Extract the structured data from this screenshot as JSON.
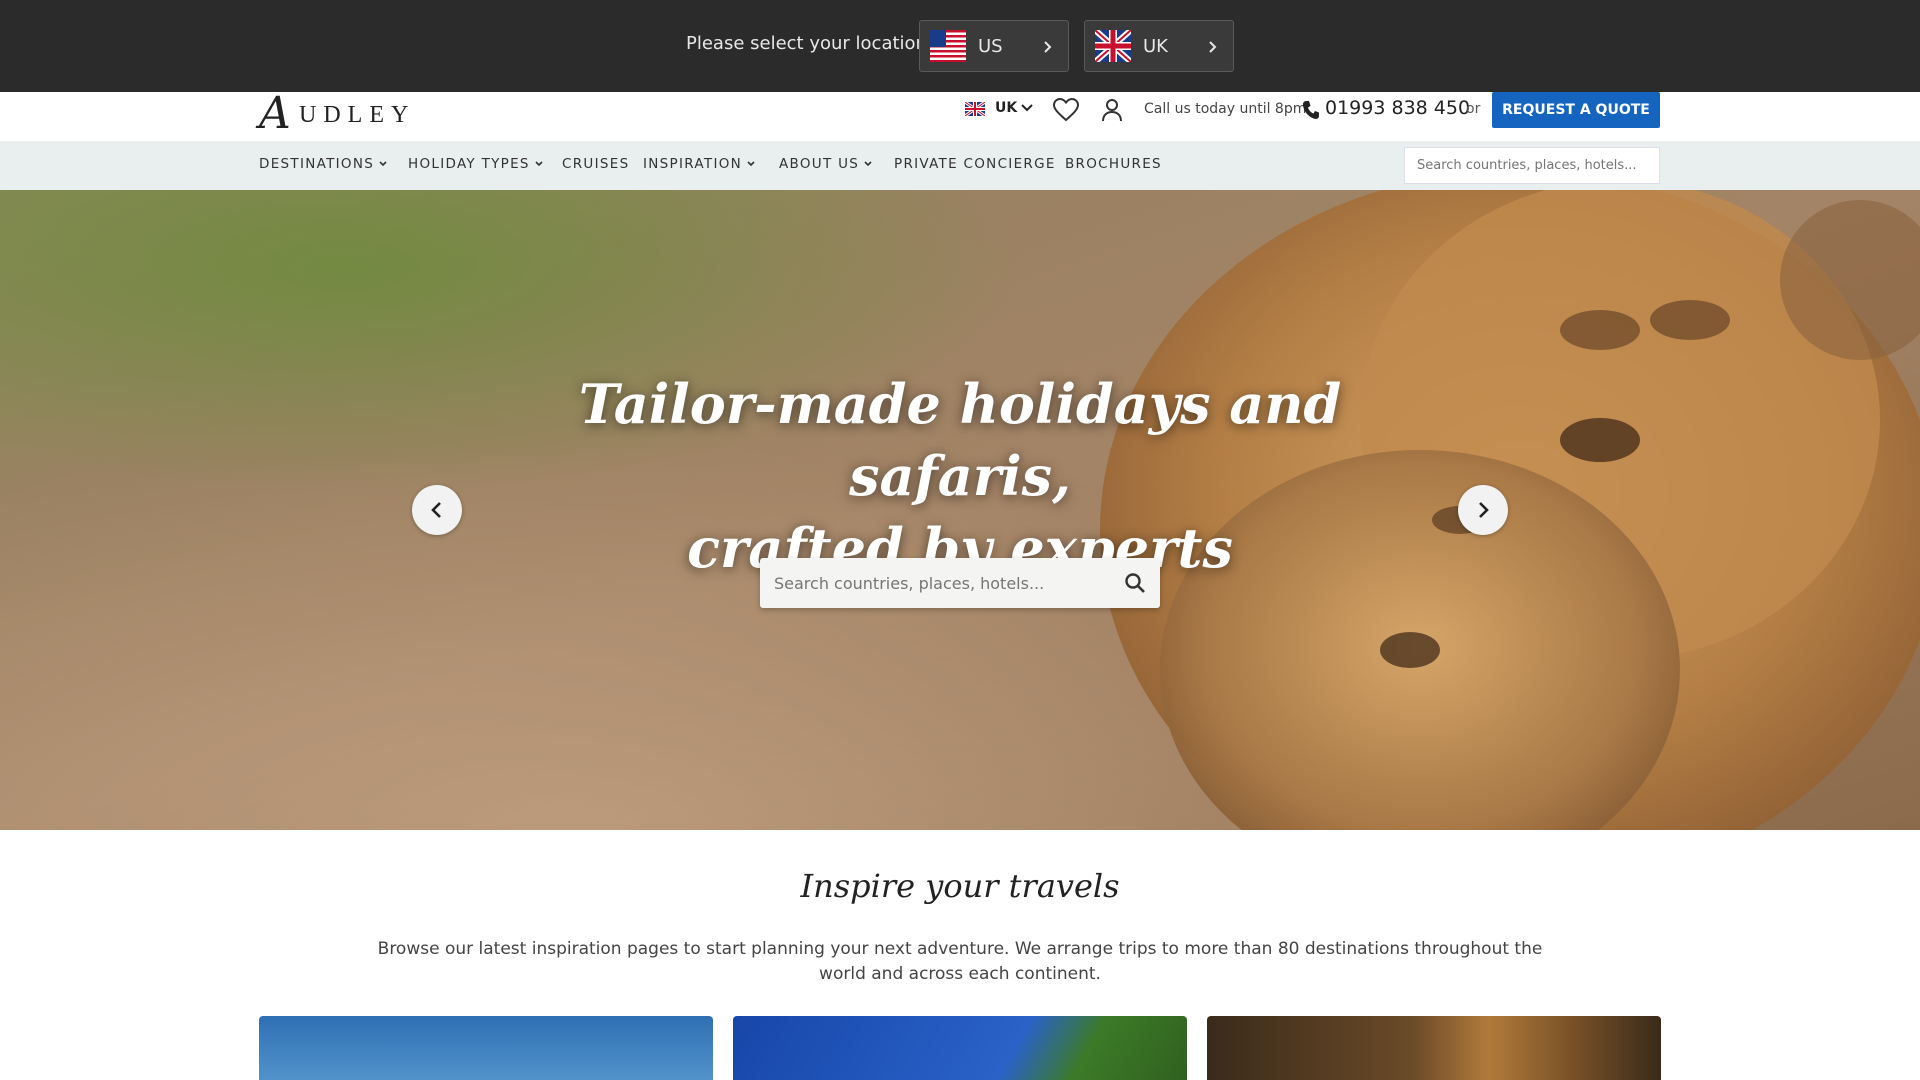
{
  "location_bar": {
    "prompt": "Please select your location:",
    "options": [
      {
        "label": "US",
        "flag": "us-flag-icon"
      },
      {
        "label": "UK",
        "flag": "uk-flag-icon"
      }
    ]
  },
  "header": {
    "logo_initial": "A",
    "logo_rest": "UDLEY",
    "country": "UK",
    "call_text": "Call us today until 8pm",
    "phone": "01993 838 450",
    "or_text": "or",
    "quote_button": "REQUEST A QUOTE"
  },
  "nav": {
    "items": [
      {
        "label": "DESTINATIONS",
        "dropdown": true
      },
      {
        "label": "HOLIDAY TYPES",
        "dropdown": true
      },
      {
        "label": "CRUISES",
        "dropdown": false
      },
      {
        "label": "INSPIRATION",
        "dropdown": true
      },
      {
        "label": "ABOUT US",
        "dropdown": true
      },
      {
        "label": "PRIVATE CONCIERGE",
        "dropdown": false
      },
      {
        "label": "BROCHURES",
        "dropdown": false
      }
    ],
    "search_placeholder": "Search countries, places, hotels..."
  },
  "hero": {
    "title_line1": "Tailor-made holidays and safaris,",
    "title_line2": "crafted by experts",
    "search_placeholder": "Search countries, places, hotels..."
  },
  "inspire": {
    "title": "Inspire your travels",
    "text": "Browse our latest inspiration pages to start planning your next adventure. We arrange trips to more than 80 destinations throughout the world and across each continent."
  },
  "colors": {
    "accent": "#1565c0",
    "location_bar_bg": "#2b2b2b",
    "nav_bg": "#e9eeee"
  }
}
